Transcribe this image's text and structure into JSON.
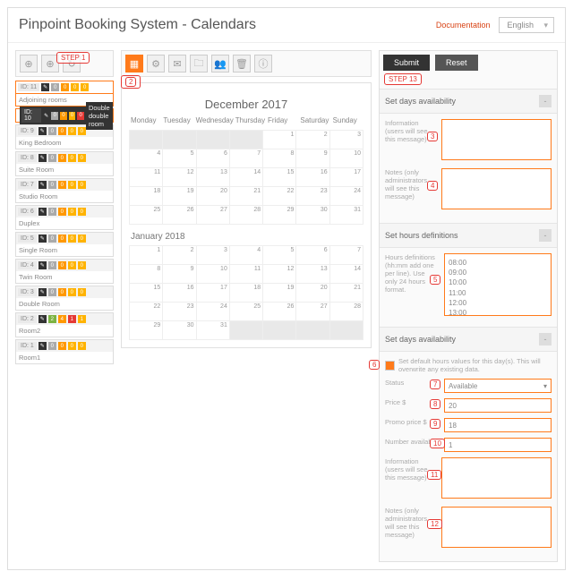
{
  "header": {
    "title": "Pinpoint Booking System - Calendars",
    "doc_link": "Documentation",
    "language": "English"
  },
  "steps": {
    "s1": "STEP 1",
    "s2": "2",
    "s3": "3",
    "s4": "4",
    "s5": "5",
    "s6": "6",
    "s7": "7",
    "s8": "8",
    "s9": "9",
    "s10": "10",
    "s11": "11",
    "s12": "12",
    "s13": "STEP 13"
  },
  "left_toolbar_icons": [
    "plus-circle",
    "plus-circle",
    "refresh"
  ],
  "rooms": [
    {
      "id": "ID: 11",
      "name": "Adjoining rooms",
      "active": true,
      "sel": false,
      "badges": [
        "black",
        "grey",
        "orange",
        "amber",
        "amber"
      ]
    },
    {
      "id": "ID: 10",
      "name": "Double double room",
      "active": false,
      "sel": true,
      "badges": [
        "black",
        "grey",
        "orange",
        "amber",
        "red"
      ]
    },
    {
      "id": "ID: 9",
      "name": "King Bedroom",
      "active": false,
      "sel": false,
      "badges": [
        "black",
        "grey",
        "orange",
        "amber",
        "amber"
      ]
    },
    {
      "id": "ID: 8",
      "name": "Suite Room",
      "active": false,
      "sel": false,
      "badges": [
        "black",
        "grey",
        "orange",
        "amber",
        "amber"
      ]
    },
    {
      "id": "ID: 7",
      "name": "Studio Room",
      "active": false,
      "sel": false,
      "badges": [
        "black",
        "grey",
        "orange",
        "amber",
        "amber"
      ]
    },
    {
      "id": "ID: 6",
      "name": "Duplex",
      "active": false,
      "sel": false,
      "badges": [
        "black",
        "grey",
        "orange",
        "amber",
        "amber"
      ]
    },
    {
      "id": "ID: 5",
      "name": "Single Room",
      "active": false,
      "sel": false,
      "badges": [
        "black",
        "grey",
        "orange",
        "amber",
        "amber"
      ]
    },
    {
      "id": "ID: 4",
      "name": "Twin Room",
      "active": false,
      "sel": false,
      "badges": [
        "black",
        "grey",
        "orange",
        "amber",
        "amber"
      ]
    },
    {
      "id": "ID: 3",
      "name": "Double Room",
      "active": false,
      "sel": false,
      "badges": [
        "black",
        "grey",
        "orange",
        "amber",
        "amber"
      ]
    },
    {
      "id": "ID: 2",
      "name": "Room2",
      "active": false,
      "sel": false,
      "badges": [
        "black",
        "green",
        "orange",
        "red",
        "amber"
      ],
      "nums": [
        "2",
        "4",
        "1",
        "1"
      ]
    },
    {
      "id": "ID: 1",
      "name": "Room1",
      "active": false,
      "sel": false,
      "badges": [
        "black",
        "grey",
        "orange",
        "amber",
        "amber"
      ]
    }
  ],
  "mid_toolbar_icons": [
    "calendar",
    "gear",
    "tag",
    "folder",
    "users",
    "trash",
    "info"
  ],
  "calendar": {
    "month1": {
      "title": "December 2017",
      "weekdays": [
        "Monday",
        "Tuesday",
        "Wednesday",
        "Thursday",
        "Friday",
        "Saturday",
        "Sunday"
      ],
      "lead": 4,
      "days": 31
    },
    "month2": {
      "title": "January 2018",
      "lead": 0,
      "days": 31
    }
  },
  "right": {
    "submit": "Submit",
    "reset": "Reset",
    "sec_days": "Set days availability",
    "info_label": "Information (users will see this message)",
    "notes_label": "Notes (only administrators will see this message)",
    "sec_hours": "Set hours definitions",
    "hours_label": "Hours definitions (hh:mm add one per line). Use only 24 hours format.",
    "hours_list": [
      "08:00",
      "09:00",
      "10:00",
      "11:00",
      "12:00",
      "13:00"
    ],
    "sec_days2": "Set days availability",
    "default_hours": "Set default hours values for this day(s). This will overwrite any existing data.",
    "status_label": "Status",
    "status_value": "Available",
    "price_label": "Price $",
    "price_value": "20",
    "promo_label": "Promo price $",
    "promo_value": "18",
    "number_label": "Number available",
    "number_value": "1"
  }
}
